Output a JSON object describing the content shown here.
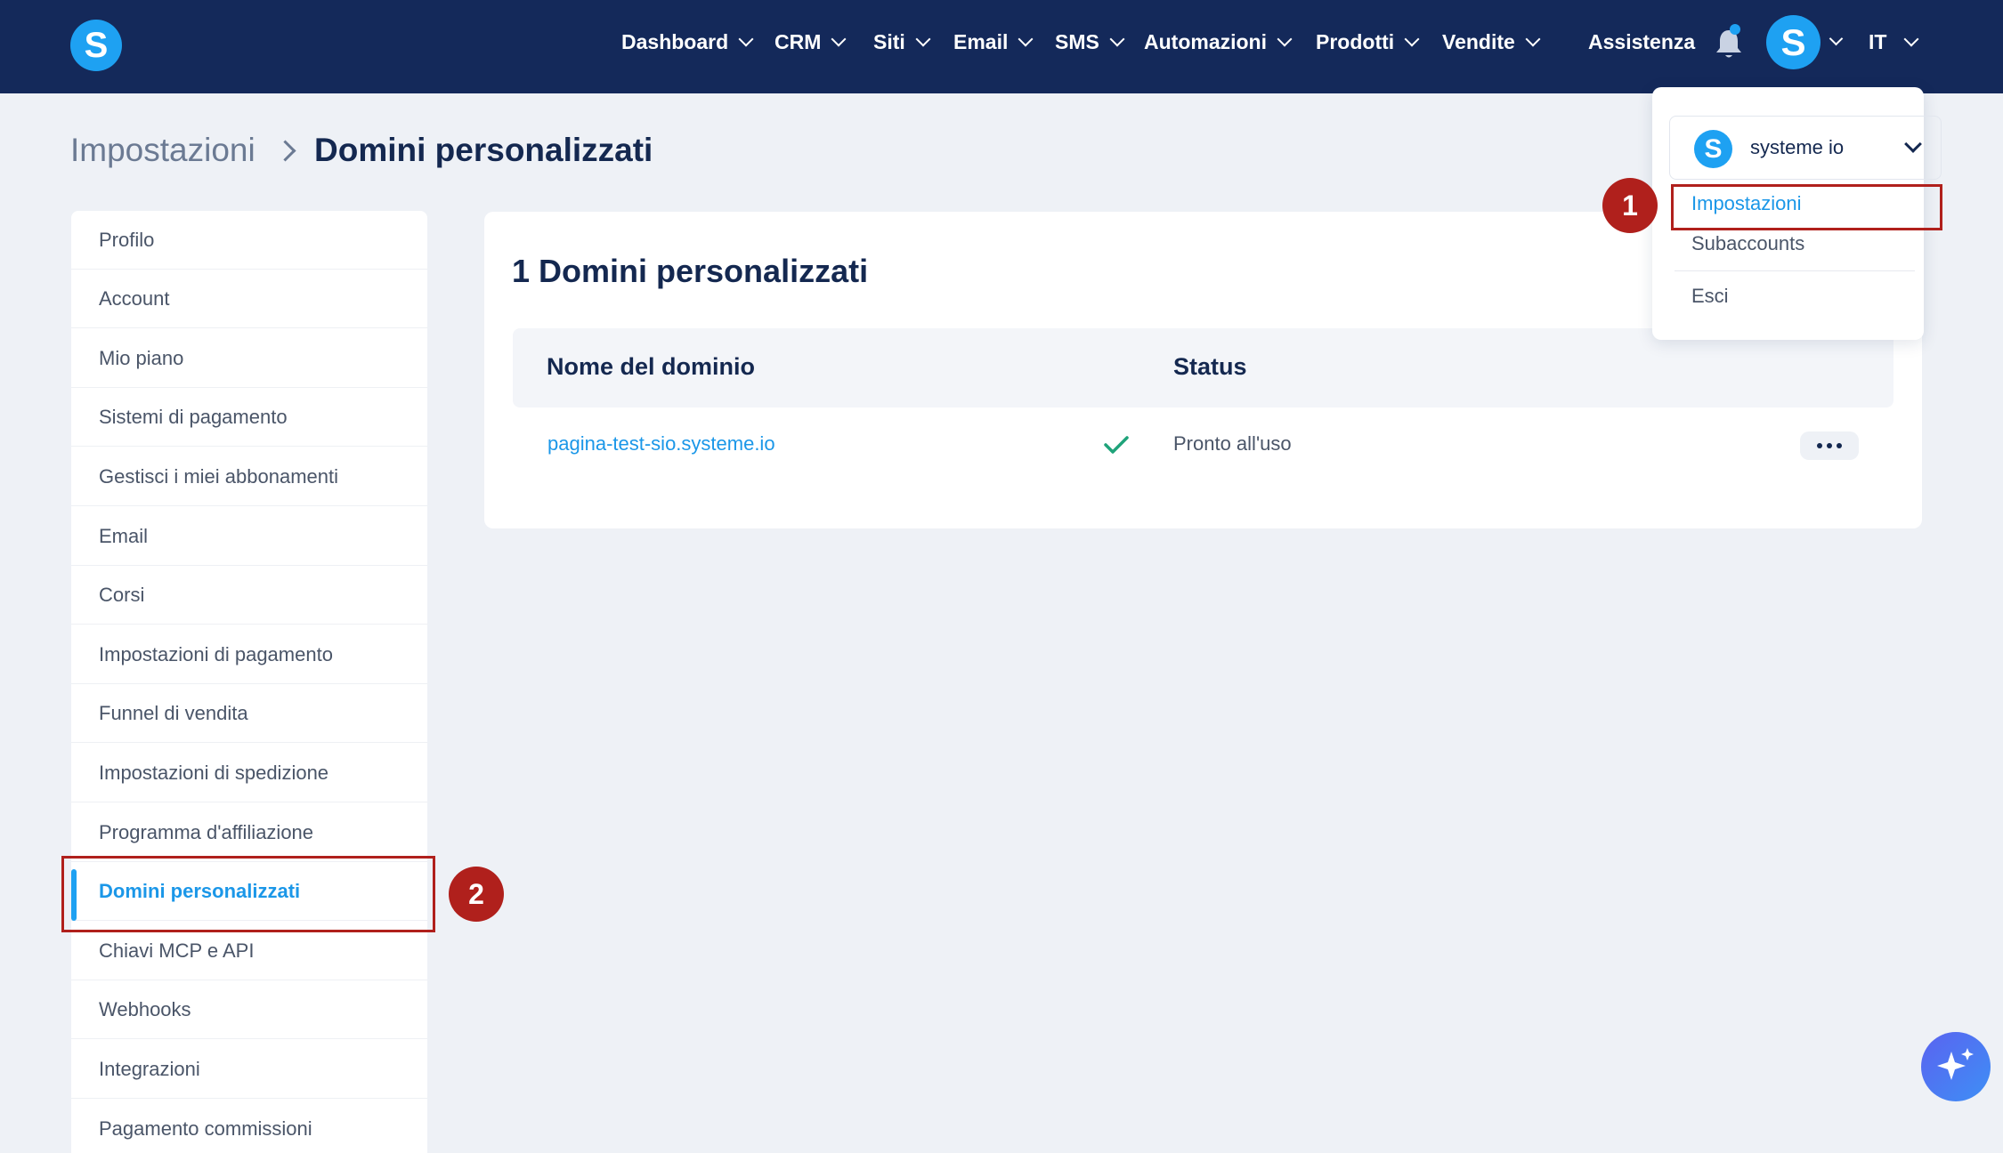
{
  "brand": {
    "logo_letter": "S",
    "accent_color": "#1ea1f2",
    "nav_bg": "#14295a",
    "highlight_color": "#b0201c"
  },
  "nav": {
    "items": [
      {
        "label": "Dashboard"
      },
      {
        "label": "CRM"
      },
      {
        "label": "Siti"
      },
      {
        "label": "Email"
      },
      {
        "label": "SMS"
      },
      {
        "label": "Automazioni"
      },
      {
        "label": "Prodotti"
      },
      {
        "label": "Vendite"
      }
    ],
    "help_label": "Assistenza",
    "avatar_letter": "S",
    "language": "IT"
  },
  "breadcrumb": {
    "parent": "Impostazioni",
    "current": "Domini personalizzati"
  },
  "sidebar": {
    "items": [
      {
        "label": "Profilo"
      },
      {
        "label": "Account"
      },
      {
        "label": "Mio piano"
      },
      {
        "label": "Sistemi di pagamento"
      },
      {
        "label": "Gestisci i miei abbonamenti"
      },
      {
        "label": "Email"
      },
      {
        "label": "Corsi"
      },
      {
        "label": "Impostazioni di pagamento"
      },
      {
        "label": "Funnel di vendita"
      },
      {
        "label": "Impostazioni di spedizione"
      },
      {
        "label": "Programma d'affiliazione"
      },
      {
        "label": "Domini personalizzati",
        "active": true
      },
      {
        "label": "Chiavi MCP e API"
      },
      {
        "label": "Webhooks"
      },
      {
        "label": "Integrazioni"
      },
      {
        "label": "Pagamento commissioni"
      }
    ]
  },
  "main": {
    "title": "1 Domini personalizzati",
    "columns": {
      "domain": "Nome del dominio",
      "status": "Status"
    },
    "rows": [
      {
        "domain": "pagina-test-sio.systeme.io",
        "status": "Pronto all'uso",
        "status_icon": "check-icon"
      }
    ]
  },
  "account_menu": {
    "account_name": "systeme io",
    "account_logo_letter": "S",
    "items": [
      {
        "label": "Impostazioni"
      },
      {
        "label": "Subaccounts"
      },
      {
        "label": "Esci"
      }
    ]
  },
  "annotations": {
    "step1": "1",
    "step2": "2"
  }
}
